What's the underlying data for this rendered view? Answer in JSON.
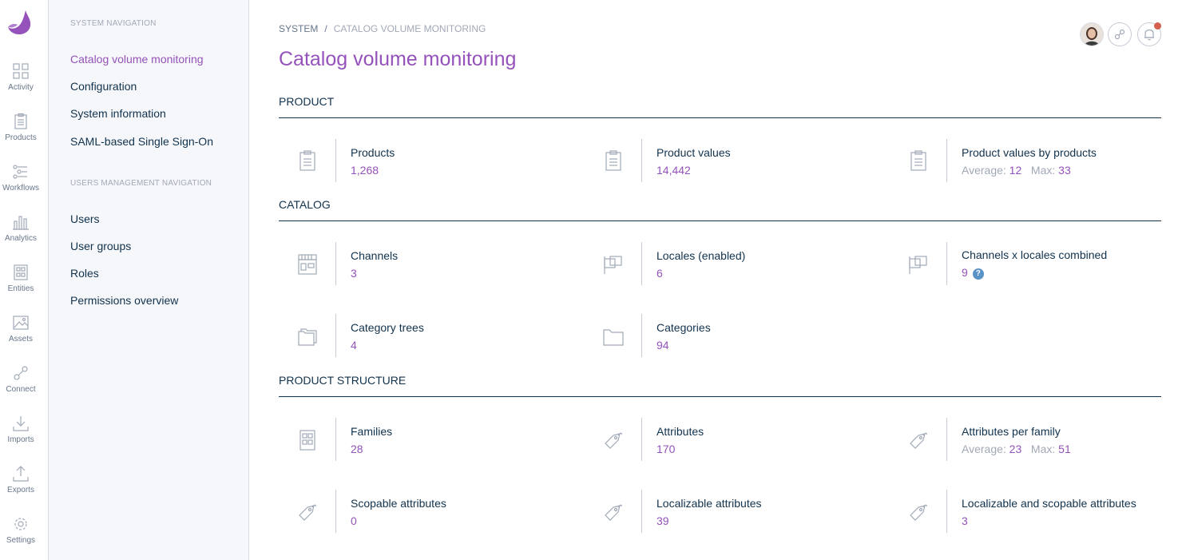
{
  "rail": {
    "items": [
      {
        "label": "Activity",
        "icon": "activity-icon"
      },
      {
        "label": "Products",
        "icon": "products-icon"
      },
      {
        "label": "Workflows",
        "icon": "workflows-icon"
      },
      {
        "label": "Analytics",
        "icon": "analytics-icon"
      },
      {
        "label": "Entities",
        "icon": "entities-icon"
      },
      {
        "label": "Assets",
        "icon": "assets-icon"
      },
      {
        "label": "Connect",
        "icon": "connect-icon"
      },
      {
        "label": "Imports",
        "icon": "imports-icon"
      },
      {
        "label": "Exports",
        "icon": "exports-icon"
      },
      {
        "label": "Settings",
        "icon": "settings-icon"
      }
    ]
  },
  "subnav": {
    "system_title": "SYSTEM NAVIGATION",
    "system_items": [
      "Catalog volume monitoring",
      "Configuration",
      "System information",
      "SAML-based Single Sign-On"
    ],
    "users_title": "USERS MANAGEMENT NAVIGATION",
    "users_items": [
      "Users",
      "User groups",
      "Roles",
      "Permissions overview"
    ]
  },
  "breadcrumb": {
    "root": "SYSTEM",
    "separator": "/",
    "current": "CATALOG VOLUME MONITORING"
  },
  "page_title": "Catalog volume monitoring",
  "sections": {
    "product": {
      "title": "PRODUCT",
      "metrics": [
        {
          "label": "Products",
          "value": "1,268",
          "icon": "clipboard-icon"
        },
        {
          "label": "Product values",
          "value": "14,442",
          "icon": "clipboard-icon"
        },
        {
          "label": "Product values by products",
          "average_label": "Average:",
          "average": "12",
          "max_label": "Max:",
          "max": "33",
          "icon": "clipboard-icon"
        }
      ]
    },
    "catalog": {
      "title": "CATALOG",
      "metrics": [
        {
          "label": "Channels",
          "value": "3",
          "icon": "shop-icon"
        },
        {
          "label": "Locales (enabled)",
          "value": "6",
          "icon": "flags-icon"
        },
        {
          "label": "Channels x locales combined",
          "value": "9",
          "help": "?",
          "icon": "flags-icon"
        },
        {
          "label": "Category trees",
          "value": "4",
          "icon": "folders-icon"
        },
        {
          "label": "Categories",
          "value": "94",
          "icon": "folder-icon"
        }
      ]
    },
    "structure": {
      "title": "PRODUCT STRUCTURE",
      "metrics": [
        {
          "label": "Families",
          "value": "28",
          "icon": "family-icon"
        },
        {
          "label": "Attributes",
          "value": "170",
          "icon": "tag-icon"
        },
        {
          "label": "Attributes per family",
          "average_label": "Average:",
          "average": "23",
          "max_label": "Max:",
          "max": "51",
          "icon": "tag-icon"
        },
        {
          "label": "Scopable attributes",
          "value": "0",
          "icon": "tag-icon"
        },
        {
          "label": "Localizable attributes",
          "value": "39",
          "icon": "tag-icon"
        },
        {
          "label": "Localizable and scopable attributes",
          "value": "3",
          "icon": "tag-icon"
        }
      ]
    }
  },
  "colors": {
    "accent": "#9452ba",
    "text": "#11324d",
    "muted": "#a1a9b7",
    "help": "#5992c7",
    "notification": "#d4604f"
  }
}
